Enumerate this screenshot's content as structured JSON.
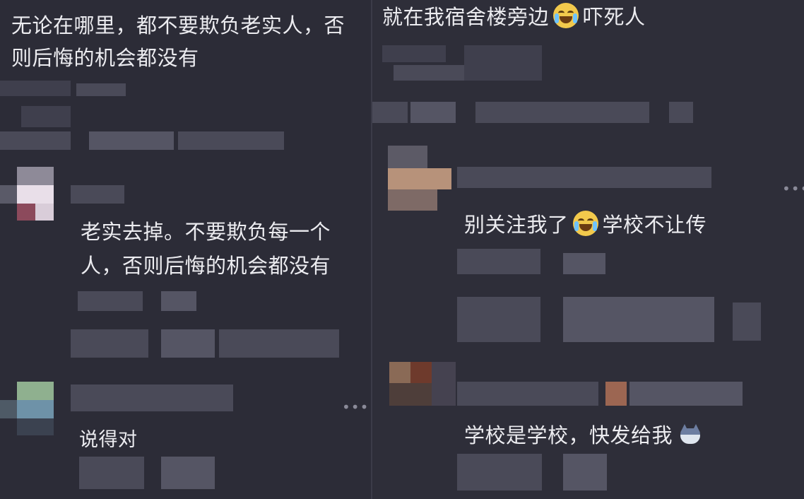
{
  "left": {
    "post_text_line1": "无论在哪里，都不要欺负老实人，否",
    "post_text_line2": "则后悔的机会都没有",
    "comment1_line1": "老实去掉。不要欺负每一个",
    "comment1_line2": "人，否则后悔的机会都没有",
    "comment2_text": "说得对",
    "more_icon": "•••"
  },
  "right": {
    "post_text_a": "就在我宿舍楼旁边",
    "post_text_b": "吓死人",
    "comment1_text_a": "别关注我了",
    "comment1_text_b": "学校不让传",
    "comment2_text": "学校是学校，快发给我",
    "more_icon": "•••"
  },
  "icons": {
    "laugh_cry": "face-with-tears-of-joy-emoji",
    "cat": "cat-face-emoji"
  },
  "colors": {
    "background": "#2c2c37",
    "text": "#ececf0",
    "blur": "#4a4a58"
  }
}
